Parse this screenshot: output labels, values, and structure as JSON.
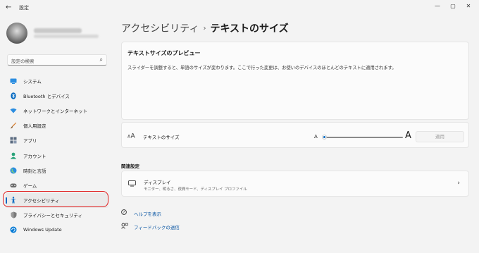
{
  "window": {
    "title": "設定",
    "back_glyph": "←",
    "controls": {
      "minimize": "—",
      "maximize": "▢",
      "close": "✕"
    }
  },
  "sidebar": {
    "search_placeholder": "設定の検索",
    "items": [
      {
        "label": "システム",
        "icon": "system-icon",
        "color": "#0078d4",
        "active": false
      },
      {
        "label": "Bluetooth とデバイス",
        "icon": "bluetooth-icon",
        "color": "#0067c0",
        "active": false
      },
      {
        "label": "ネットワークとインターネット",
        "icon": "network-icon",
        "color": "#0078d4",
        "active": false
      },
      {
        "label": "個人用設定",
        "icon": "brush-icon",
        "color": "#d87b2a",
        "active": false
      },
      {
        "label": "アプリ",
        "icon": "apps-icon",
        "color": "#5b6b80",
        "active": false
      },
      {
        "label": "アカウント",
        "icon": "account-icon",
        "color": "#2aa37a",
        "active": false
      },
      {
        "label": "時刻と言語",
        "icon": "globe-icon",
        "color": "#1f7ab8",
        "active": false
      },
      {
        "label": "ゲーム",
        "icon": "game-icon",
        "color": "#6b6b6b",
        "active": false
      },
      {
        "label": "アクセシビリティ",
        "icon": "accessibility-icon",
        "color": "#0067c0",
        "active": true
      },
      {
        "label": "プライバシーとセキュリティ",
        "icon": "shield-icon",
        "color": "#6b6b6b",
        "active": false
      },
      {
        "label": "Windows Update",
        "icon": "update-icon",
        "color": "#0078d4",
        "active": false
      }
    ]
  },
  "main": {
    "breadcrumb_parent": "アクセシビリティ",
    "breadcrumb_sep": "›",
    "breadcrumb_current": "テキストのサイズ",
    "preview": {
      "title": "テキストサイズのプレビュー",
      "text": "スライダーを調整すると、単語のサイズが変わります。ここで行った変更は、お使いのデバイスのほとんどのテキストに適用されます。"
    },
    "text_size": {
      "label": "テキストのサイズ",
      "small_a": "A",
      "large_a": "A",
      "slider_value_fraction": 0,
      "apply_label": "適用"
    },
    "related": {
      "heading": "関連設定",
      "display_title": "ディスプレイ",
      "display_subtitle": "モニター、明るさ、夜間モード、ディスプレイ プロファイル"
    },
    "links": {
      "help": "ヘルプを表示",
      "feedback": "フィードバックの送信"
    }
  },
  "colors": {
    "accent": "#0067c0",
    "highlight": "#e01a1a"
  }
}
